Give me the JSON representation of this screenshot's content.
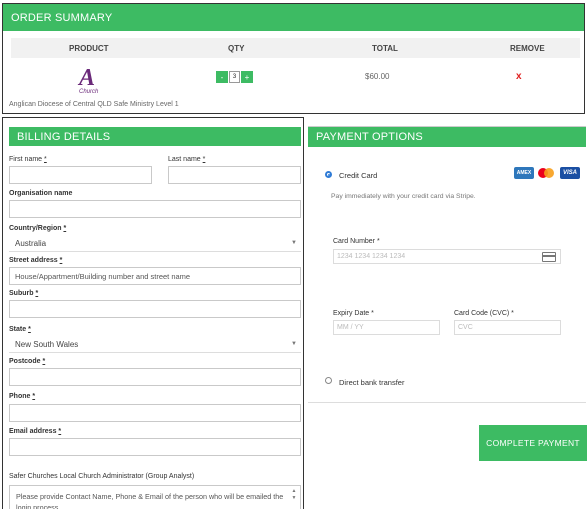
{
  "order_summary": {
    "title": "ORDER SUMMARY",
    "columns": [
      "PRODUCT",
      "QTY",
      "TOTAL",
      "REMOVE"
    ],
    "item": {
      "logo_text": "Church",
      "logo_glyph": "A",
      "name": "Anglican Diocese of Central QLD Safe Ministry Level 1",
      "qty_minus": "-",
      "qty": "3",
      "qty_plus": "+",
      "total": "$60.00",
      "remove": "x"
    },
    "colors": {
      "accent": "#3dbb63",
      "remove": "#e02020",
      "logo": "#6b2a7a"
    }
  },
  "billing": {
    "title": "BILLING DETAILS",
    "first_name_label": "First name",
    "last_name_label": "Last name",
    "required_mark": "*",
    "organisation_label": "Organisation name",
    "country_label": "Country/Region",
    "country_value": "Australia",
    "street_label": "Street address",
    "street_placeholder": "House/Appartment/Building number and street name",
    "suburb_label": "Suburb",
    "state_label": "State",
    "state_value": "New South Wales",
    "postcode_label": "Postcode",
    "phone_label": "Phone",
    "email_label": "Email address",
    "admin_label": "Safer Churches Local Church Administrator (Group Analyst)",
    "admin_placeholder": "Please provide Contact Name, Phone & Email of the person who will be emailed the login process"
  },
  "payment": {
    "title": "PAYMENT OPTIONS",
    "credit_card_label": "Credit Card",
    "credit_card_note": "Pay immediately with your credit card via Stripe.",
    "card_logos": [
      "AMEX",
      "mastercard",
      "VISA"
    ],
    "card_number_label": "Card Number *",
    "card_number_placeholder": "1234 1234 1234 1234",
    "expiry_label": "Expiry Date *",
    "expiry_placeholder": "MM / YY",
    "cvc_label": "Card Code (CVC) *",
    "cvc_placeholder": "CVC",
    "bank_transfer_label": "Direct bank transfer",
    "selected_method": "credit_card"
  },
  "complete_button": "COMPLETE PAYMENT"
}
